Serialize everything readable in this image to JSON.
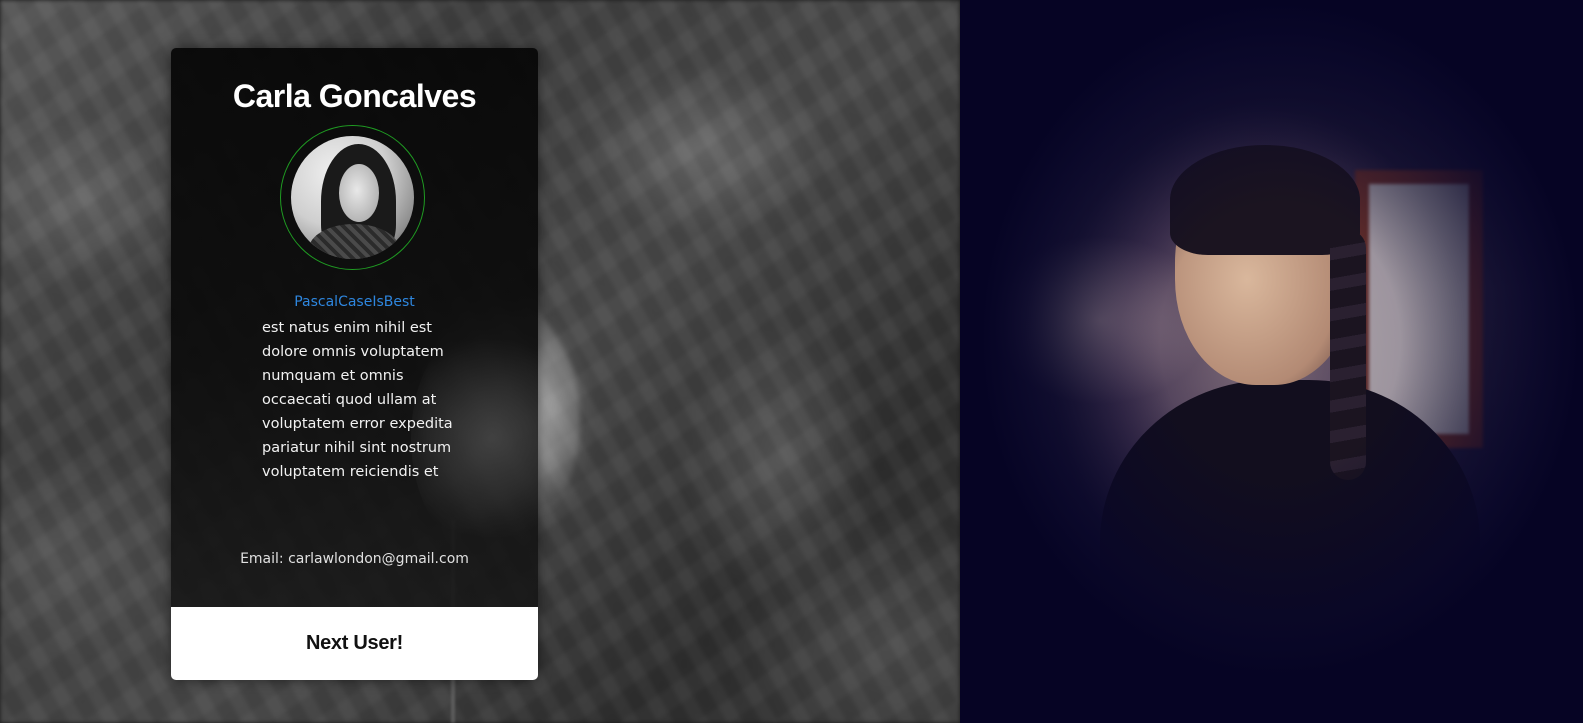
{
  "profile": {
    "name": "Carla Goncalves",
    "username": "PascalCaseIsBest",
    "bio": "est natus enim nihil est dolore omnis voluptatem numquam et omnis occaecati quod ullam at voluptatem error expedita pariatur nihil sint nostrum voluptatem reiciendis et",
    "email": "Email: carlawlondon@gmail.com"
  },
  "actions": {
    "next_label": "Next User!"
  },
  "colors": {
    "card_background": "#0a0a0a",
    "avatar_ring": "#1f9c22",
    "username_link": "#2e86de",
    "button_background": "#ffffff",
    "button_text": "#111111",
    "photo_tint": "#0b0a22"
  }
}
